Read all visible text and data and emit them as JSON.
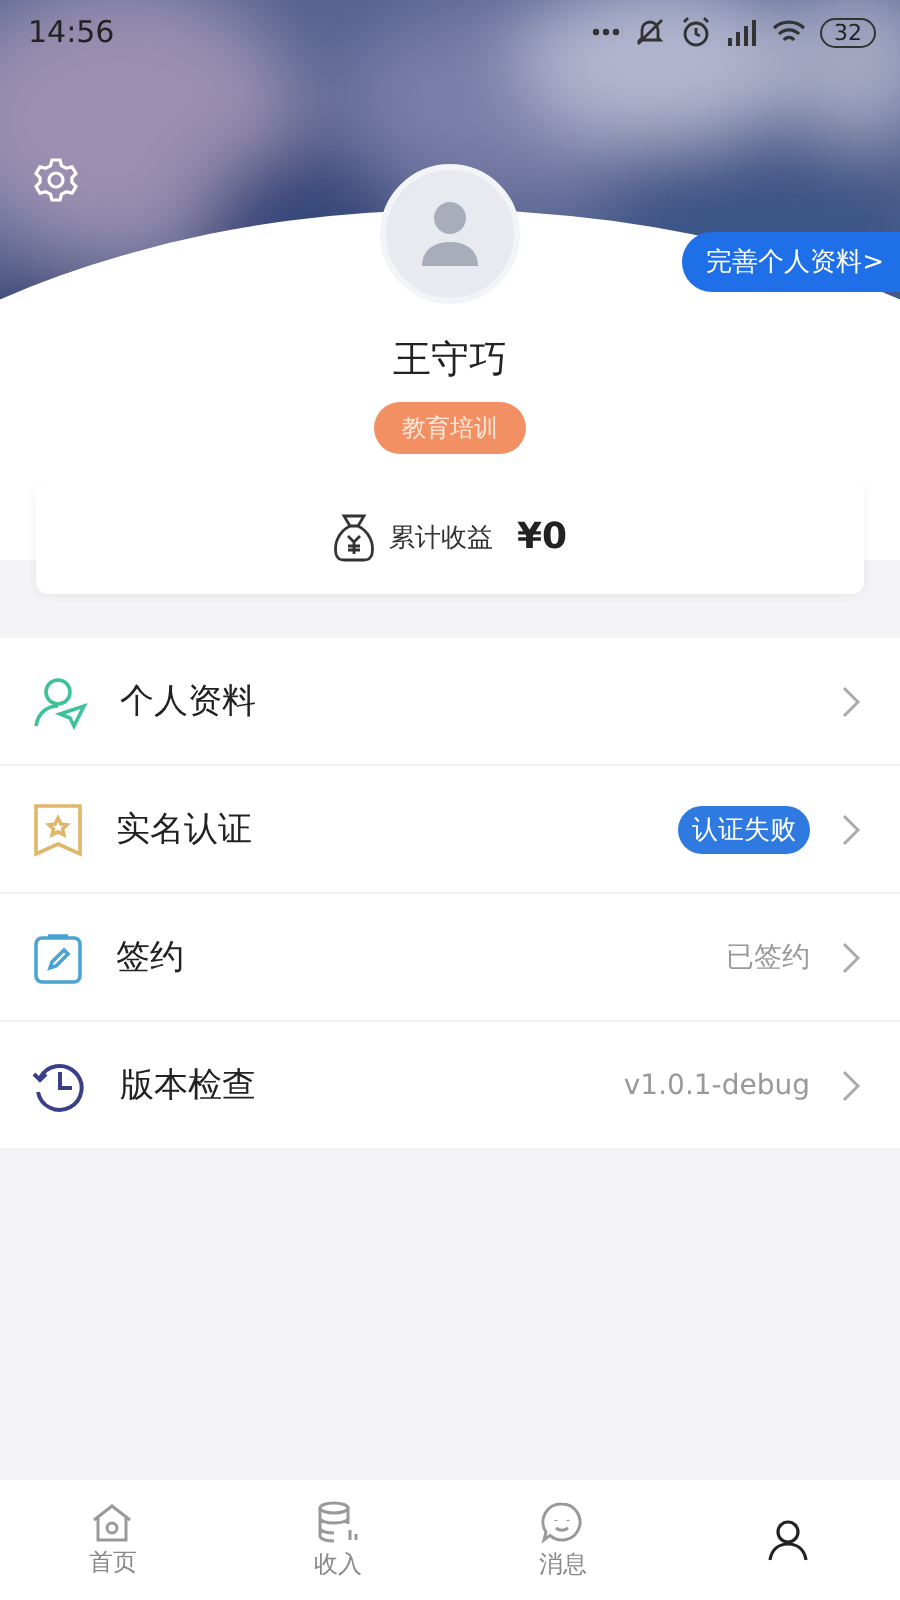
{
  "status_bar": {
    "time": "14:56",
    "battery": "32"
  },
  "profile": {
    "name": "王守巧",
    "tag": "教育培训",
    "complete_link": "完善个人资料>"
  },
  "earnings": {
    "label": "累计收益",
    "value": "¥0"
  },
  "menu": [
    {
      "kind": "profile",
      "label": "个人资料"
    },
    {
      "kind": "verify",
      "label": "实名认证",
      "badge": "认证失败"
    },
    {
      "kind": "sign",
      "label": "签约",
      "value": "已签约"
    },
    {
      "kind": "version",
      "label": "版本检查",
      "value": "v1.0.1-debug"
    }
  ],
  "tab_bar": [
    {
      "kind": "home",
      "label": "首页",
      "selected": false
    },
    {
      "kind": "income",
      "label": "收入",
      "selected": false
    },
    {
      "kind": "message",
      "label": "消息",
      "selected": false
    },
    {
      "kind": "me",
      "selected": true
    }
  ]
}
